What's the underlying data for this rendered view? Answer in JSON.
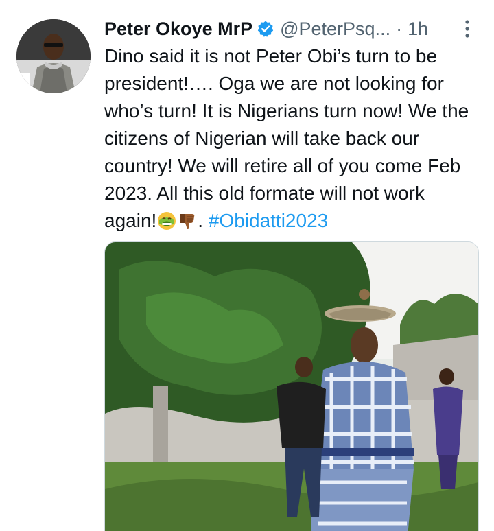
{
  "author": {
    "name": "Peter Okoye MrP",
    "handle": "@PeterPsq...",
    "separator": "·",
    "time": "1h",
    "verified_icon": "verified-badge-icon",
    "avatar_icon": "profile-photo-avatar"
  },
  "tweet": {
    "text": "Dino said it is not Peter Obi’s turn to be president!…. Oga we are not looking for who’s turn! It is Nigerians turn now! We the citizens of Nigerian will take back our country! We will retire all of you come Feb 2023. All this old formate will not work again!",
    "emoji_1": "nauseated-face-emoji",
    "emoji_2": "thumbs-down-emoji",
    "after_emoji": ". ",
    "hashtag": "#Obidatti2023"
  },
  "more_icon": "more-options-icon",
  "media_icon": "attached-photo",
  "colors": {
    "text": "#0f1419",
    "muted": "#536471",
    "accent": "#1d9bf0"
  }
}
